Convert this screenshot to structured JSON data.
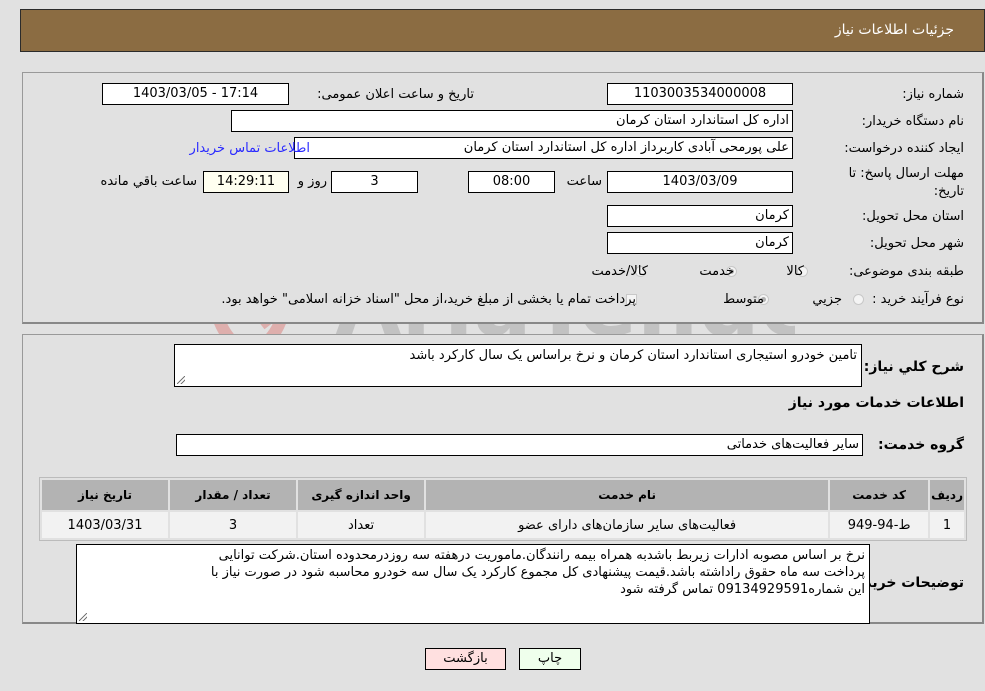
{
  "header": {
    "title": "جزئیات اطلاعات نیاز"
  },
  "details": {
    "need_number": {
      "label": "شماره نیاز:",
      "value": "1103003534000008"
    },
    "announce_datetime": {
      "label": "تاریخ و ساعت اعلان عمومی:",
      "value": "1403/03/05 - 17:14"
    },
    "buyer_org": {
      "label": "نام دستگاه خریدار:",
      "value": "اداره کل استاندارد استان کرمان"
    },
    "requester": {
      "label": "ایجاد کننده درخواست:",
      "value": "علی پورمحی آبادی کاربرداز اداره کل استاندارد استان کرمان"
    },
    "buyer_contact_link": "اطلاعات تماس خریدار",
    "deadline": {
      "label": "مهلت ارسال پاسخ: تا تاریخ:",
      "date": "1403/03/09",
      "time_label": "ساعت",
      "time": "08:00",
      "days": "3",
      "days_label": "روز و",
      "remaining": "14:29:11",
      "remaining_label": "ساعت باقي مانده"
    },
    "delivery_province": {
      "label": "استان محل تحویل:",
      "value": "کرمان"
    },
    "delivery_city": {
      "label": "شهر محل تحویل:",
      "value": "کرمان"
    },
    "category": {
      "label": "طبقه بندی موضوعی:",
      "options": [
        "کالا",
        "خدمت",
        "کالا/خدمت"
      ],
      "selected": "خدمت"
    },
    "purchase_process": {
      "label": "نوع فرآیند خرید :",
      "options": [
        "جزيي",
        "متوسط"
      ],
      "selected": "متوسط",
      "treasury_note": "پرداخت تمام یا بخشی از مبلغ خرید،از محل \"اسناد خزانه اسلامی\" خواهد بود.",
      "treasury_checked": false
    }
  },
  "summary": {
    "label": "شرح کلي نياز:",
    "value": "تامین خودرو استیجاری استاندارد استان کرمان  و نرخ براساس یک سال کارکرد باشد"
  },
  "services_section": {
    "title": "اطلاعات خدمات مورد نیاز",
    "group_label": "گروه خدمت:",
    "group_value": "سایر فعالیت‌های خدماتی",
    "table": {
      "headers": [
        "ردیف",
        "کد خدمت",
        "نام خدمت",
        "واحد اندازه گیری",
        "تعداد / مقدار",
        "تاریخ نیاز"
      ],
      "rows": [
        [
          "1",
          "ط-94-949",
          "فعالیت‌های سایر سازمان‌های دارای عضو",
          "تعداد",
          "3",
          "1403/03/31"
        ]
      ]
    }
  },
  "buyer_notes": {
    "label": "توضیحات خریدار:",
    "lines": [
      "نرخ بر اساس مصوبه ادارات زیربط باشدبه همراه بیمه رانندگان.ماموریت درهفته سه روزدرمحدوده استان.شرکت توانایی",
      "پرداخت سه ماه حقوق راداشته باشد.قیمت پیشنهادی کل مجموع کارکرد یک سال سه خودرو  محاسبه شود در صورت نیاز با",
      "این شماره09134929591 تماس گرفته شود"
    ]
  },
  "buttons": {
    "print": "چاپ",
    "back": "بازگشت"
  },
  "colors": {
    "header_bg": "#8b6c42",
    "print_bg": "#efffec",
    "back_bg": "#ffe0e0",
    "link": "#2a2aff"
  }
}
